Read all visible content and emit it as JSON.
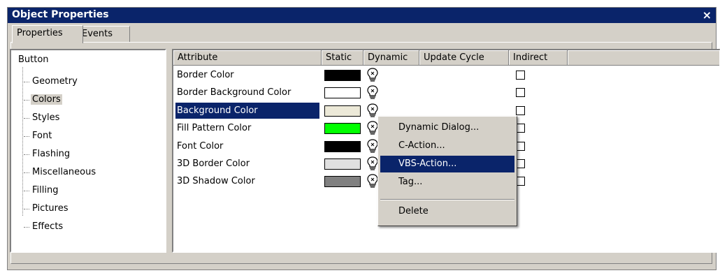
{
  "window": {
    "title": "Object Properties",
    "close_label": "×"
  },
  "tabs": [
    {
      "label": "Properties",
      "active": true
    },
    {
      "label": "Events",
      "active": false
    }
  ],
  "tree": {
    "root": "Button",
    "items": [
      "Geometry",
      "Colors",
      "Styles",
      "Font",
      "Flashing",
      "Miscellaneous",
      "Filling",
      "Pictures",
      "Effects"
    ],
    "selected": "Colors"
  },
  "grid": {
    "columns": [
      "Attribute",
      "Static",
      "Dynamic",
      "Update Cycle",
      "Indirect"
    ],
    "rows": [
      {
        "attribute": "Border Color",
        "color": "#000000"
      },
      {
        "attribute": "Border Background Color",
        "color": "#ffffff"
      },
      {
        "attribute": "Background Color",
        "color": "#ece9d8"
      },
      {
        "attribute": "Fill Pattern Color",
        "color": "#00ff00"
      },
      {
        "attribute": "Font Color",
        "color": "#000000"
      },
      {
        "attribute": "3D Border Color",
        "color": "#e0e0e0"
      },
      {
        "attribute": "3D Shadow Color",
        "color": "#808080"
      }
    ],
    "selected_row": "Background Color"
  },
  "context_menu": {
    "items": [
      "Dynamic Dialog...",
      "C-Action...",
      "VBS-Action...",
      "Tag..."
    ],
    "delete_label": "Delete",
    "highlighted": "VBS-Action..."
  },
  "colors": {
    "titlebar": "#0a246a",
    "face": "#d4d0c8",
    "selection": "#0a246a"
  }
}
